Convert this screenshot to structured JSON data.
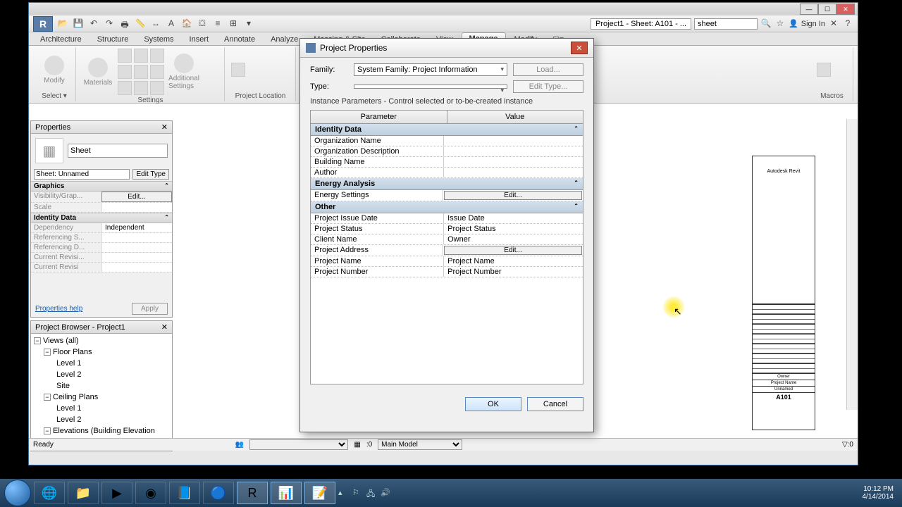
{
  "titlebar": {
    "doc_title": "Project1 - Sheet: A101 - ...",
    "search_value": "sheet"
  },
  "qat": {
    "sign_in": "Sign In"
  },
  "ribbon": {
    "tabs": [
      "Architecture",
      "Structure",
      "Systems",
      "Insert",
      "Annotate",
      "Analyze",
      "Massing & Site",
      "Collaborate",
      "View",
      "Manage",
      "Modify"
    ],
    "active_tab_index": 9,
    "panels": {
      "select": {
        "label": "Select",
        "sub": "▾",
        "modify_btn": "Modify"
      },
      "settings": {
        "label": "Settings",
        "materials_btn": "Materials",
        "additional_btn": "Additional\nSettings"
      },
      "project_location": {
        "label": "Project Location"
      },
      "macros": {
        "label": "Macros"
      }
    }
  },
  "properties": {
    "panel_title": "Properties",
    "type_label": "Sheet",
    "instance": "Sheet: Unnamed",
    "edit_type": "Edit Type",
    "groups": {
      "graphics": {
        "title": "Graphics",
        "visibility": {
          "k": "Visibility/Grap...",
          "v": "Edit..."
        },
        "scale": {
          "k": "Scale",
          "v": ""
        }
      },
      "identity": {
        "title": "Identity Data",
        "dependency": {
          "k": "Dependency",
          "v": "Independent"
        },
        "ref_s": {
          "k": "Referencing S...",
          "v": ""
        },
        "ref_d": {
          "k": "Referencing D...",
          "v": ""
        },
        "cur_rev": {
          "k": "Current Revisi...",
          "v": ""
        },
        "cur_rev2": {
          "k": "Current Revisi",
          "v": ""
        }
      }
    },
    "help_link": "Properties help",
    "apply": "Apply"
  },
  "browser": {
    "panel_title": "Project Browser - Project1",
    "views_root": "Views (all)",
    "floor_plans": "Floor Plans",
    "fp_levels": [
      "Level 1",
      "Level 2",
      "Site"
    ],
    "ceiling_plans": "Ceiling Plans",
    "cp_levels": [
      "Level 1",
      "Level 2"
    ],
    "elevations": "Elevations (Building Elevation"
  },
  "dialog": {
    "title": "Project Properties",
    "family_label": "Family:",
    "family_value": "System Family: Project Information",
    "load_btn": "Load...",
    "type_label": "Type:",
    "type_value": "",
    "edit_type_btn": "Edit Type...",
    "hint": "Instance Parameters - Control selected or to-be-created instance",
    "col_parameter": "Parameter",
    "col_value": "Value",
    "groups": [
      {
        "title": "Identity Data",
        "rows": [
          {
            "k": "Organization Name",
            "v": ""
          },
          {
            "k": "Organization Description",
            "v": ""
          },
          {
            "k": "Building Name",
            "v": ""
          },
          {
            "k": "Author",
            "v": ""
          }
        ]
      },
      {
        "title": "Energy Analysis",
        "rows": [
          {
            "k": "Energy Settings",
            "v": "Edit...",
            "btn": true
          }
        ]
      },
      {
        "title": "Other",
        "rows": [
          {
            "k": "Project Issue Date",
            "v": "Issue Date"
          },
          {
            "k": "Project Status",
            "v": "Project Status"
          },
          {
            "k": "Client Name",
            "v": "Owner"
          },
          {
            "k": "Project Address",
            "v": "Edit...",
            "btn": true
          },
          {
            "k": "Project Name",
            "v": "Project Name"
          },
          {
            "k": "Project Number",
            "v": "Project Number"
          }
        ]
      }
    ],
    "ok": "OK",
    "cancel": "Cancel"
  },
  "sheet_preview": {
    "brand": "Autodesk Revit",
    "owner": "Owner",
    "proj_name": "Project Name",
    "sheet_name": "Unnamed",
    "sheet_num": "A101"
  },
  "status": {
    "ready": "Ready",
    "zero": ":0",
    "main_model": "Main Model",
    "filter_zero": ":0"
  },
  "taskbar": {
    "clock_time": "10:12 PM",
    "clock_date": "4/14/2014"
  }
}
